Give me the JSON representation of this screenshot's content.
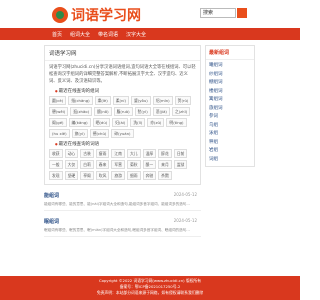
{
  "header": {
    "logo_text": "词语学习网",
    "search_placeholder": "搜索"
  },
  "nav": {
    "items": [
      "首页",
      "组词大全",
      "带名词语",
      "汉字大全"
    ]
  },
  "main": {
    "title": "词语学习网",
    "intro": "词语学习网(zhucidi.cn)分享汉语词语组词,造句词语大全等在线组词、可以轻松查询汉字组词的详细完整答案解析,不断拓展汉字大全、汉字造句、近义词、反义词、及汉语知识等。",
    "recent_heading": "最近在线查询的组词",
    "recent_tags": [
      "圆(cè)",
      "指(chǎng)",
      "樂(lè)",
      "柔(ní)",
      "婆(yǒu)",
      "绍(mǐn)",
      "贺(rǔ)",
      "憩(wěi)",
      "逛(zhāo)",
      "酿(nǒ)",
      "腹(ruò)",
      "愁(yì)",
      "悲(jiǎ)",
      "之(zhī)",
      "阁(gé)",
      "编(kǎng)",
      "晒(dú)",
      "妇(ài)",
      "洗(lǐ)",
      "亦(zū)",
      "明(tíng)",
      "(hu xíē)",
      "旅(yì)",
      "德(chǔ)",
      "碎(yuán)"
    ],
    "recent_words_heading": "最近在线查询的词语",
    "recent_words": [
      "收获",
      "动心",
      "古装",
      "瘦雨",
      "江南",
      "大儿",
      "温厚",
      "醉花",
      "日前",
      "一般",
      "大仅",
      "白莉",
      "春来",
      "军营",
      "菊秋",
      "酿一",
      "来月",
      "监狱",
      "发现",
      "坚硬",
      "亭阁",
      "吹风",
      "旅游",
      "细雨",
      "奔驰",
      "杀戮"
    ]
  },
  "articles": [
    {
      "title": "能组词",
      "date": "2024-05-12",
      "text": "能组词有哪些、能的意思、能(nài)字组词大全和造句,能组词多音字组词、能组词多的造句..."
    },
    {
      "title": "眠组词",
      "date": "2024-05-12",
      "text": "眠组词有哪些、眠的意思、眠(mián)字组词大全和造句,眠组词多音字组词、眠组词的造句..."
    }
  ],
  "sidebar": {
    "title": "最新组词",
    "items": [
      "曦组词",
      "纱组词",
      "棚组词",
      "楼组词",
      "篱组词",
      "旅组词",
      "参词",
      "乌组",
      "泳组",
      "秤组",
      "岩组",
      "词组"
    ]
  },
  "footer": {
    "line1": "Copyright ©2022 词语学习网(www.zhucidi.cn) 版权所有",
    "line2": "备案号：鄂ICP备2021017250号-2",
    "line3": "免责声明：本站部分词语来源于网络，如有侵权请联系我们删除"
  },
  "colors": {
    "brand": "#d9381e",
    "link": "#2b4f86"
  }
}
